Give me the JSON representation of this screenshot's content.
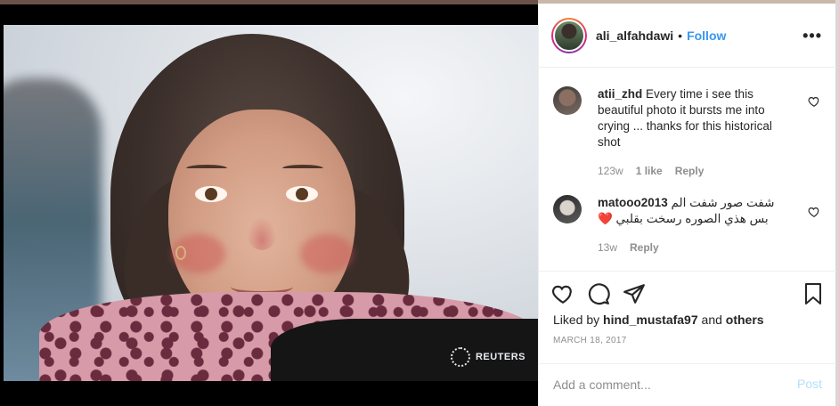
{
  "header": {
    "username": "ali_alfahdawi",
    "separator": "•",
    "follow_label": "Follow",
    "more_label": "•••"
  },
  "photo": {
    "watermark": "REUTERS"
  },
  "comments": [
    {
      "username": "atii_zhd",
      "text": "Every time i see this beautiful photo it bursts me into crying ... thanks for this historical shot",
      "age": "123w",
      "likes": "1 like",
      "reply_label": "Reply"
    },
    {
      "username": "matooo2013",
      "text": "شفت صور شفت الم بس هذي الصوره رسخت بقلبي ❤️",
      "age": "13w",
      "reply_label": "Reply"
    }
  ],
  "liked_by": {
    "prefix": "Liked by",
    "user": "hind_mustafa97",
    "connector": "and",
    "others": "others"
  },
  "date": "MARCH 18, 2017",
  "add_comment": {
    "placeholder": "Add a comment...",
    "post_label": "Post"
  },
  "colors": {
    "link_blue": "#3897f0",
    "post_disabled": "#b2dffc",
    "muted_text": "#8e8e8e"
  },
  "icons": [
    "heart-icon",
    "comment-icon",
    "share-icon",
    "bookmark-icon",
    "more-icon"
  ]
}
